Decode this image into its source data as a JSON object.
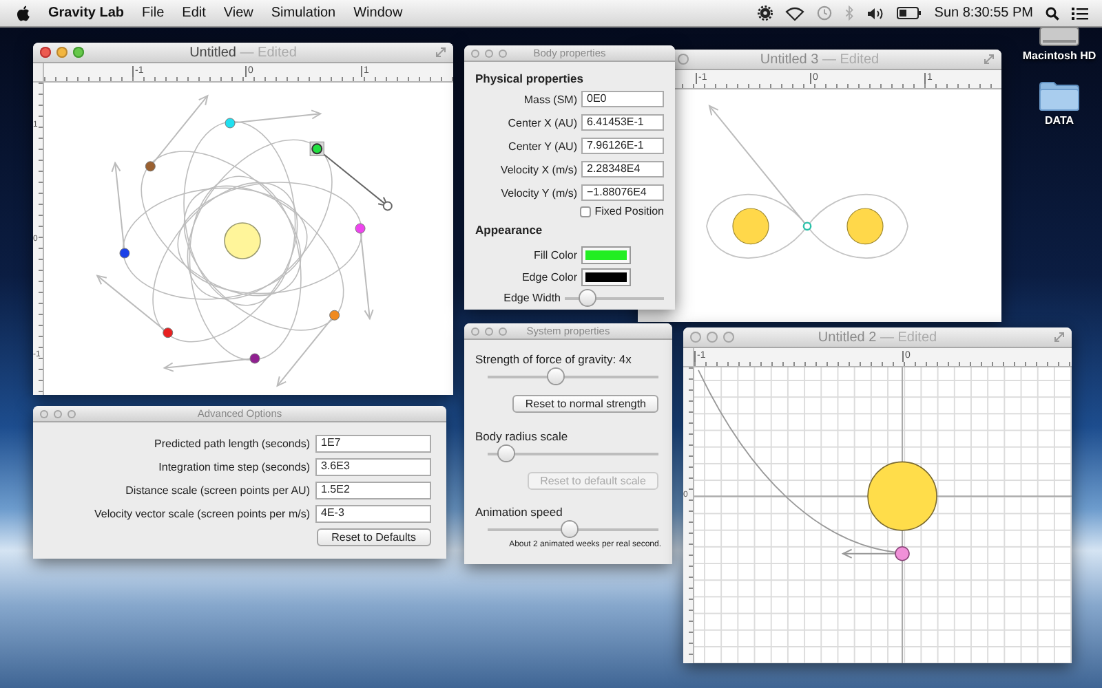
{
  "menu_bar": {
    "app_name": "Gravity Lab",
    "menus": [
      "File",
      "Edit",
      "View",
      "Simulation",
      "Window"
    ],
    "clock": "Sun 8:30:55 PM"
  },
  "desktop_icons": [
    {
      "kind": "drive",
      "label": "Macintosh HD"
    },
    {
      "kind": "folder",
      "label": "DATA"
    }
  ],
  "untitled_window": {
    "title": "Untitled",
    "status": "— Edited",
    "active": true,
    "ruler_labels": [
      "-1",
      "0",
      "1"
    ],
    "side_ruler_labels": [
      "1",
      "0",
      "-1"
    ],
    "bodies": [
      {
        "color": "#20e0f0",
        "selected": false
      },
      {
        "color": "#22e040",
        "selected": true
      },
      {
        "color": "#ee44ee",
        "selected": false
      },
      {
        "color": "#f08a20",
        "selected": false
      },
      {
        "color": "#902090",
        "selected": false
      },
      {
        "color": "#e82020",
        "selected": false
      },
      {
        "color": "#1a40e8",
        "selected": false
      },
      {
        "color": "#9a6030",
        "selected": false
      }
    ]
  },
  "body_properties": {
    "title": "Body properties",
    "physical_heading": "Physical properties",
    "fields": [
      {
        "label": "Mass (SM)",
        "value": "0E0"
      },
      {
        "label": "Center X (AU)",
        "value": "6.41453E-1"
      },
      {
        "label": "Center Y (AU)",
        "value": "7.96126E-1"
      },
      {
        "label": "Velocity X (m/s)",
        "value": "2.28348E4"
      },
      {
        "label": "Velocity Y (m/s)",
        "value": "−1.88076E4"
      }
    ],
    "fixed_position": {
      "label": "Fixed Position",
      "checked": false
    },
    "appearance_heading": "Appearance",
    "fill_color": {
      "label": "Fill Color",
      "color": "#22ee22"
    },
    "edge_color": {
      "label": "Edge Color",
      "color": "#000000"
    },
    "edge_width": {
      "label": "Edge Width",
      "level": 0.23
    }
  },
  "untitled_3_window": {
    "title": "Untitled 3",
    "status": "— Edited",
    "active": false,
    "ruler_labels": [
      "-1",
      "0",
      "1"
    ]
  },
  "system_properties": {
    "title": "System properties",
    "gravity_label": "Strength of force of gravity: 4x",
    "gravity_slider": {
      "level": 0.4
    },
    "reset_strength_button": {
      "label": "Reset to normal strength",
      "disabled": false
    },
    "radius_label": "Body radius scale",
    "radius_slider": {
      "level": 0.11
    },
    "reset_scale_button": {
      "label": "Reset to default scale",
      "disabled": true
    },
    "speed_label": "Animation speed",
    "speed_slider": {
      "level": 0.48
    },
    "speed_note": "About 2 animated weeks per real second."
  },
  "untitled_2_window": {
    "title": "Untitled 2",
    "status": "— Edited",
    "active": false,
    "ruler_labels": [
      "-1",
      "0"
    ],
    "side_ruler_labels": [
      "0"
    ]
  },
  "advanced_options": {
    "title": "Advanced Options",
    "fields": [
      {
        "label": "Predicted path length (seconds)",
        "value": "1E7"
      },
      {
        "label": "Integration time step (seconds)",
        "value": "3.6E3"
      },
      {
        "label": "Distance scale (screen points per AU)",
        "value": "1.5E2"
      },
      {
        "label": "Velocity vector scale (screen points per m/s)",
        "value": "4E-3"
      }
    ],
    "reset_button": "Reset to Defaults"
  }
}
